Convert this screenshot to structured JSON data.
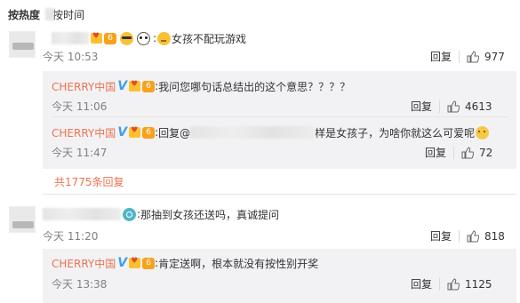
{
  "sort": {
    "active": "按热度",
    "other": "按时间"
  },
  "comments": [
    {
      "text": "女孩不配玩游戏",
      "time": "今天 10:53",
      "reply_label": "回复",
      "likes": "977"
    },
    {
      "text": "那抽到女孩还送吗，真诚提问",
      "time": "今天 11:20",
      "reply_label": "回复",
      "likes": "818"
    }
  ],
  "replies": [
    {
      "author": "CHERRY中国",
      "text": "我问您哪句话总结出的这个意思？？？？",
      "time": "今天 11:06",
      "reply_label": "回复",
      "likes": "4613"
    },
    {
      "author": "CHERRY中国",
      "prefix": "回复@",
      "text": "样是女孩子，为啥你就这么可爱呢",
      "time": "今天 11:47",
      "reply_label": "回复",
      "likes": "72"
    },
    {
      "author": "CHERRY中国",
      "text": "肯定送啊，根本就没有按性别开奖",
      "time": "今天 13:38",
      "reply_label": "回复",
      "likes": "1125"
    }
  ],
  "more_replies": "共1775条回复",
  "colors": {
    "link": "#eb7350",
    "verified": "#3f9df0",
    "sub_bg": "#f2f2f5"
  }
}
